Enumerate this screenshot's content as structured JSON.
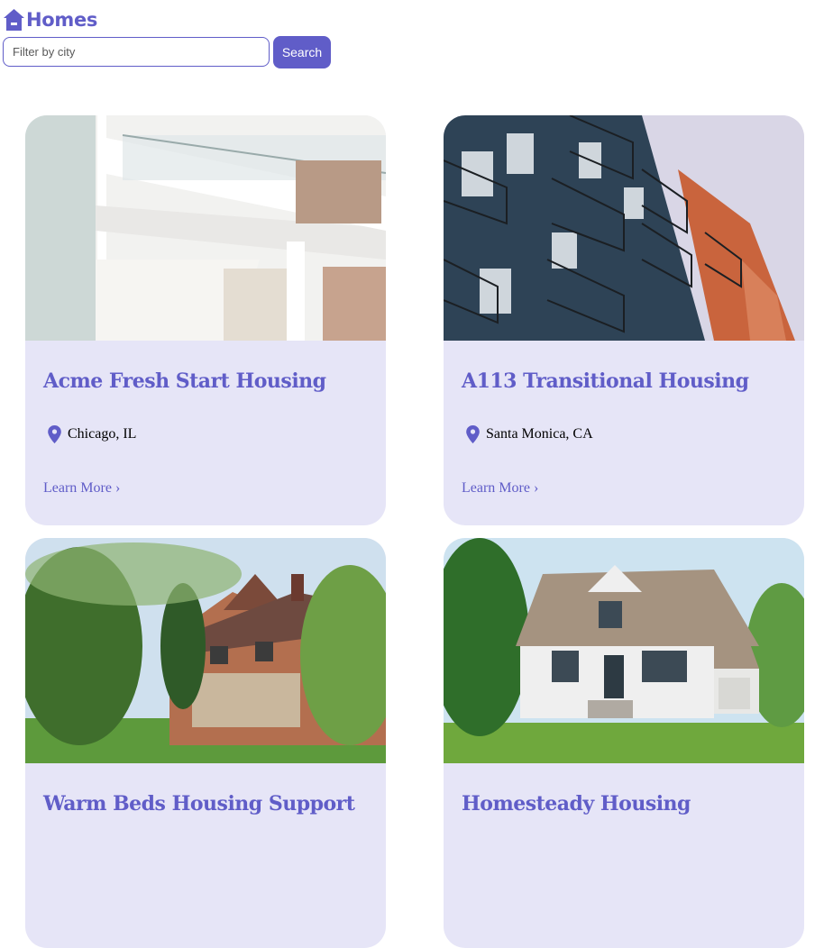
{
  "header": {
    "brand": "Homes",
    "logo_icon": "house-icon",
    "accent_color": "#605DC8"
  },
  "search": {
    "placeholder": "Filter by city",
    "value": "",
    "button_label": "Search"
  },
  "listings": [
    {
      "title": "Acme Fresh Start Housing",
      "location": "Chicago, IL",
      "link_label": "Learn More ›",
      "photo": "white-modern-apartment-balconies"
    },
    {
      "title": "A113 Transitional Housing",
      "location": "Santa Monica, CA",
      "link_label": "Learn More ›",
      "photo": "blue-orange-apartment-tower"
    },
    {
      "title": "Warm Beds Housing Support",
      "location": "",
      "link_label": "",
      "photo": "victorian-brick-house-trees"
    },
    {
      "title": "Homesteady Housing",
      "location": "",
      "link_label": "",
      "photo": "white-cottage-green-lawn"
    }
  ],
  "icons": {
    "location": "location-pin-icon"
  },
  "colors": {
    "card_background": "#E6E5F7",
    "accent": "#605DC8"
  }
}
